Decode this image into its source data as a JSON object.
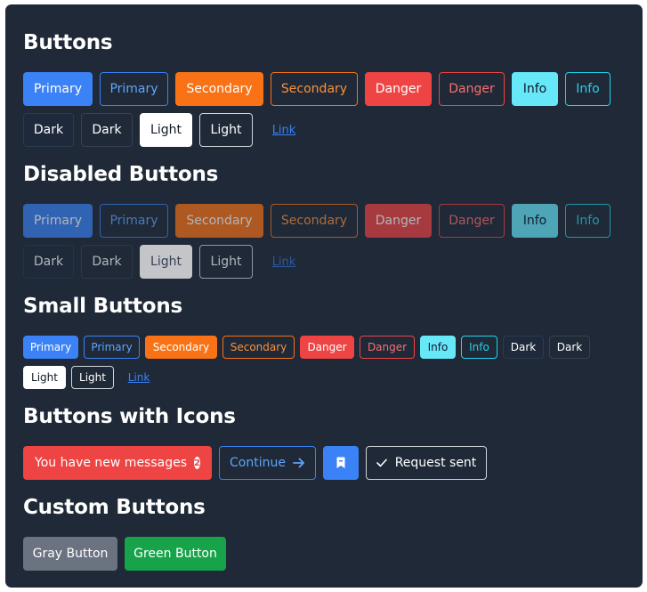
{
  "sections": {
    "buttons": "Buttons",
    "disabled": "Disabled Buttons",
    "small": "Small Buttons",
    "icons": "Buttons with Icons",
    "custom": "Custom Buttons"
  },
  "labels": {
    "primary": "Primary",
    "secondary": "Secondary",
    "danger": "Danger",
    "info": "Info",
    "dark": "Dark",
    "light": "Light",
    "link": "Link"
  },
  "icon_buttons": {
    "messages": "You have new messages",
    "messages_count": "2",
    "continue": "Continue",
    "request_sent": "Request sent"
  },
  "custom_buttons": {
    "gray": "Gray Button",
    "green": "Green Button"
  },
  "icons": {
    "continue": "arrow-right-icon",
    "bookmark": "bookmark-icon",
    "request_sent": "check-icon"
  },
  "colors": {
    "background": "#1f2937",
    "primary": "#3b82f6",
    "secondary": "#f97316",
    "danger": "#ef4444",
    "info": "#67e8f9",
    "light": "#ffffff",
    "gray": "#6b7280",
    "green": "#16a34a"
  }
}
